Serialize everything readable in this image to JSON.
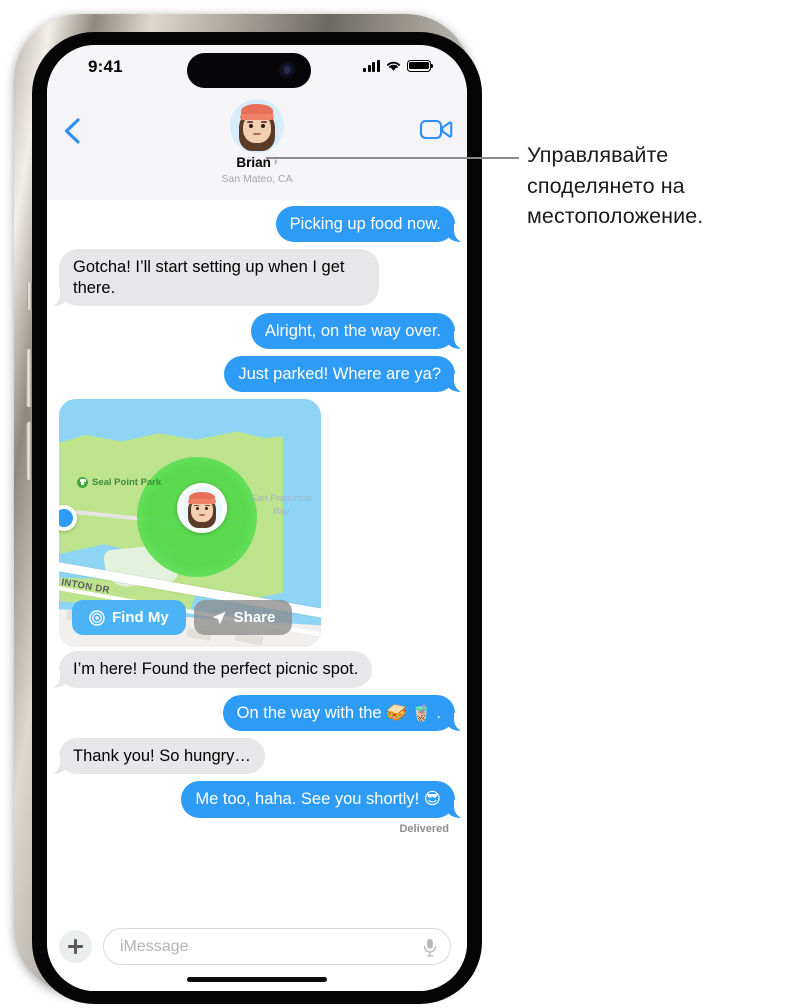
{
  "status_bar": {
    "time": "9:41",
    "signal_icon": "cellular-signal-icon",
    "wifi_icon": "wifi-icon",
    "battery_icon": "battery-icon"
  },
  "header": {
    "back_icon": "back-chevron-icon",
    "video_icon": "facetime-video-icon",
    "avatar_name": "memoji-avatar",
    "contact_name": "Brian",
    "contact_chevron": "›",
    "contact_subtitle": "San Mateo, CA"
  },
  "callout": {
    "text": "Управлявайте споделянето на местоположение."
  },
  "messages": [
    {
      "side": "out",
      "text": "Picking up food now."
    },
    {
      "side": "in",
      "text": "Gotcha! I’ll start setting up when I get there."
    },
    {
      "side": "out",
      "text": "Alright, on the way over."
    },
    {
      "side": "out",
      "text": "Just parked! Where are ya?"
    },
    {
      "side": "in",
      "text": "I’m here! Found the perfect picnic spot."
    },
    {
      "side": "out",
      "text": "On the way with the 🥪 🧋 ."
    },
    {
      "side": "in",
      "text": "Thank you! So hungry…"
    },
    {
      "side": "out",
      "text": "Me too, haha. See you shortly! 😎"
    }
  ],
  "delivered_label": "Delivered",
  "map_card": {
    "park_label": "Seal Point Park",
    "park_icon": "park-marker-icon",
    "bay_label": "San Francisco Bay",
    "road_label": "INTON DR",
    "person_pin": "shared-location-avatar-pin",
    "user_dot": "current-location-dot",
    "find_my_label": "Find My",
    "find_my_icon": "findmy-target-icon",
    "share_label": "Share",
    "share_icon": "share-arrow-icon",
    "accent_blue": "#4cb4f5",
    "geofence_green": "#55d84c"
  },
  "input_bar": {
    "plus_icon": "plus-attachment-icon",
    "placeholder": "iMessage",
    "mic_icon": "microphone-icon",
    "home_indicator": "home-indicator"
  },
  "colors": {
    "outgoing_bubble": "#2e9bf7",
    "incoming_bubble": "#e7e7e9",
    "header_bg": "#f5f5f7",
    "link_blue": "#2e9bf7"
  }
}
